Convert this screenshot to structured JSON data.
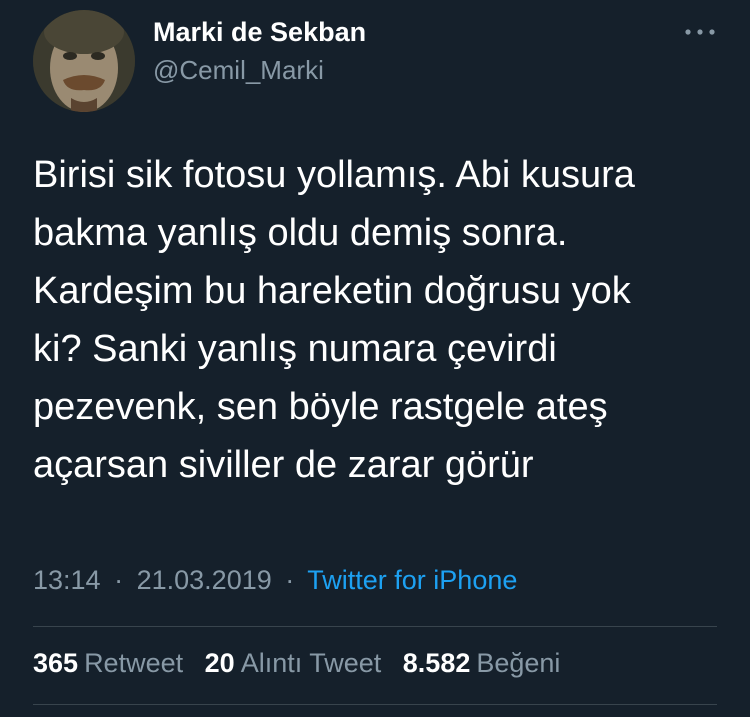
{
  "author": {
    "display_name": "Marki de Sekban",
    "handle": "@Cemil_Marki",
    "avatar_icon": "profile-photo"
  },
  "tweet": {
    "lines": [
      "Birisi sik fotosu yollamış. Abi kusura",
      "bakma yanlış oldu demiş sonra.",
      "Kardeşim bu hareketin doğrusu yok",
      "ki? Sanki yanlış numara çevirdi",
      "pezevenk, sen böyle rastgele ateş",
      "açarsan siviller de zarar görür"
    ]
  },
  "meta": {
    "time": "13:14",
    "separator": "·",
    "date": "21.03.2019",
    "source": "Twitter for iPhone"
  },
  "stats": {
    "retweets": {
      "count": "365",
      "label": "Retweet"
    },
    "quotes": {
      "count": "20",
      "label": "Alıntı Tweet"
    },
    "likes": {
      "count": "8.582",
      "label": "Beğeni"
    }
  },
  "colors": {
    "background": "#15202b",
    "text": "#ffffff",
    "secondary": "#8899a6",
    "link": "#1da1f2",
    "divider": "#38444d"
  }
}
